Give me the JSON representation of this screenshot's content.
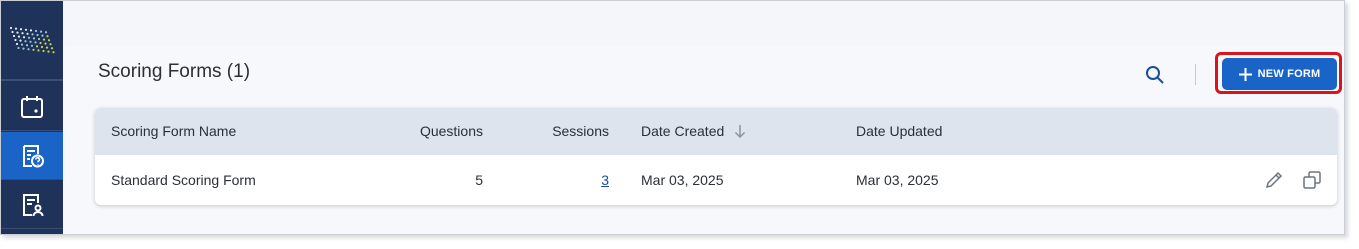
{
  "page": {
    "title": "Scoring Forms (1)"
  },
  "toolbar": {
    "search_icon": "search-icon",
    "new_button_label": "NEW FORM",
    "new_button_icon": "plus-icon"
  },
  "sidebar": {
    "items": [
      {
        "name": "calendar",
        "icon": "calendar-icon",
        "active": false
      },
      {
        "name": "scoring-forms",
        "icon": "form-question-icon",
        "active": true
      },
      {
        "name": "evaluations",
        "icon": "form-person-icon",
        "active": false
      }
    ]
  },
  "table": {
    "columns": [
      "Scoring Form Name",
      "Questions",
      "Sessions",
      "Date Created",
      "Date Updated"
    ],
    "sort_column": "Date Created",
    "sort_direction": "descending",
    "rows": [
      {
        "name": "Standard Scoring Form",
        "questions": "5",
        "sessions": "3",
        "date_created": "Mar 03, 2025",
        "date_updated": "Mar 03, 2025",
        "actions": [
          "pencil-icon",
          "copy-icon"
        ]
      }
    ]
  },
  "colors": {
    "sidebar": "#1f3259",
    "accent": "#1a64c8",
    "highlight": "#d9141f",
    "table_header": "#dde4ee"
  }
}
